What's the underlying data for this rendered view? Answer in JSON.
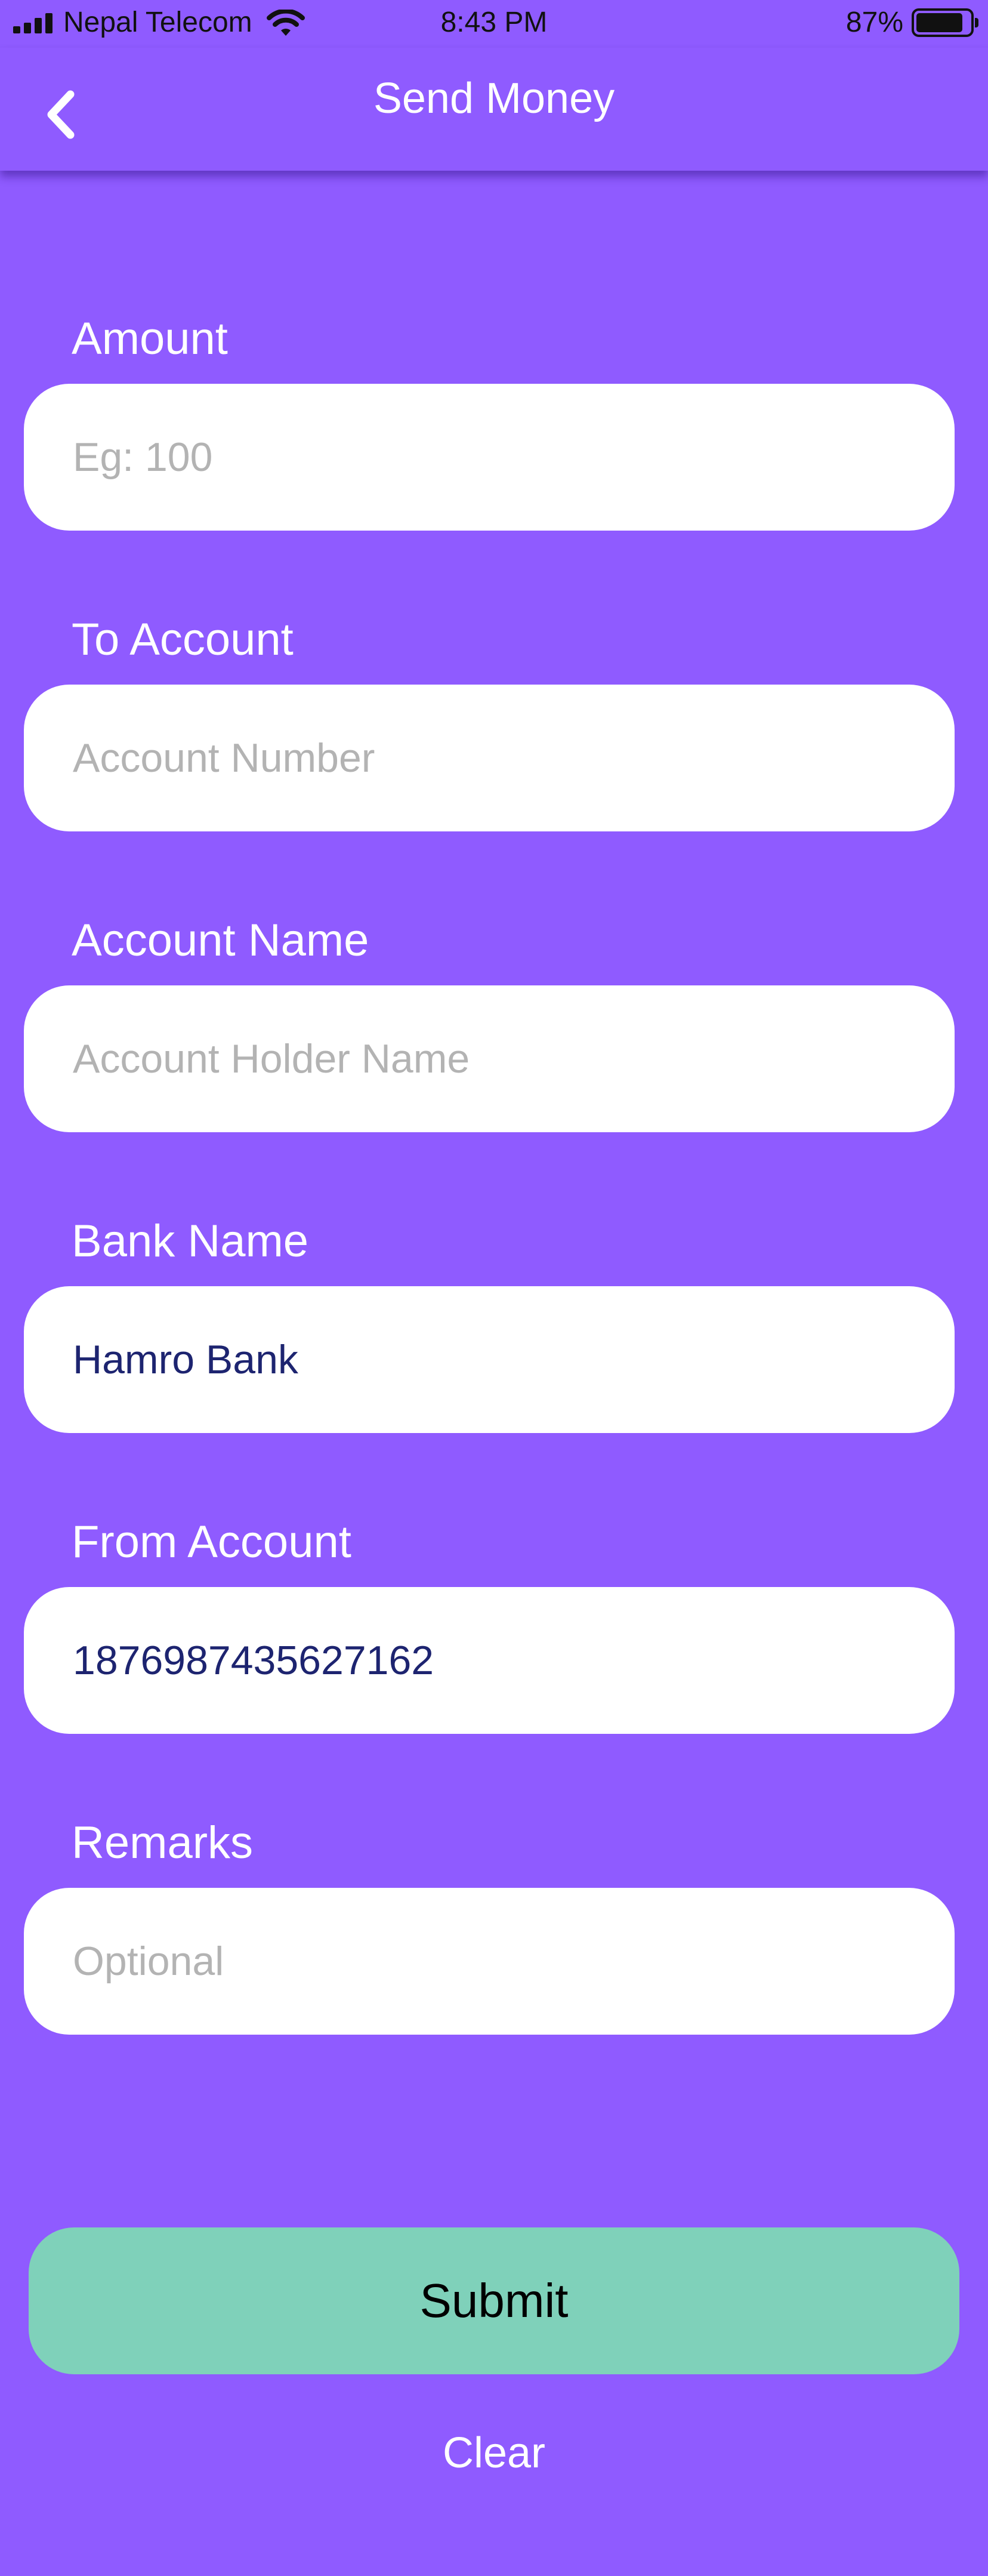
{
  "status_bar": {
    "carrier": "Nepal Telecom",
    "time": "8:43 PM",
    "battery_percent": "87%",
    "battery_level": 0.87,
    "icons": [
      "signal-icon",
      "wifi-icon",
      "battery-icon"
    ]
  },
  "nav": {
    "title": "Send Money",
    "back_icon": "chevron-left-icon"
  },
  "form": {
    "amount": {
      "label": "Amount",
      "placeholder": "Eg: 100",
      "value": ""
    },
    "to_account": {
      "label": "To Account",
      "placeholder": "Account Number",
      "value": ""
    },
    "account_name": {
      "label": "Account Name",
      "placeholder": "Account Holder Name",
      "value": ""
    },
    "bank_name": {
      "label": "Bank Name",
      "placeholder": "",
      "value": "Hamro Bank"
    },
    "from_account": {
      "label": "From Account",
      "placeholder": "",
      "value": "1876987435627162"
    },
    "remarks": {
      "label": "Remarks",
      "placeholder": "Optional",
      "value": ""
    }
  },
  "actions": {
    "submit_label": "Submit",
    "clear_label": "Clear"
  },
  "colors": {
    "background": "#8f5bff",
    "submit": "#7fd1ba",
    "input_text": "#1d2470",
    "placeholder": "#b3b3b3"
  }
}
